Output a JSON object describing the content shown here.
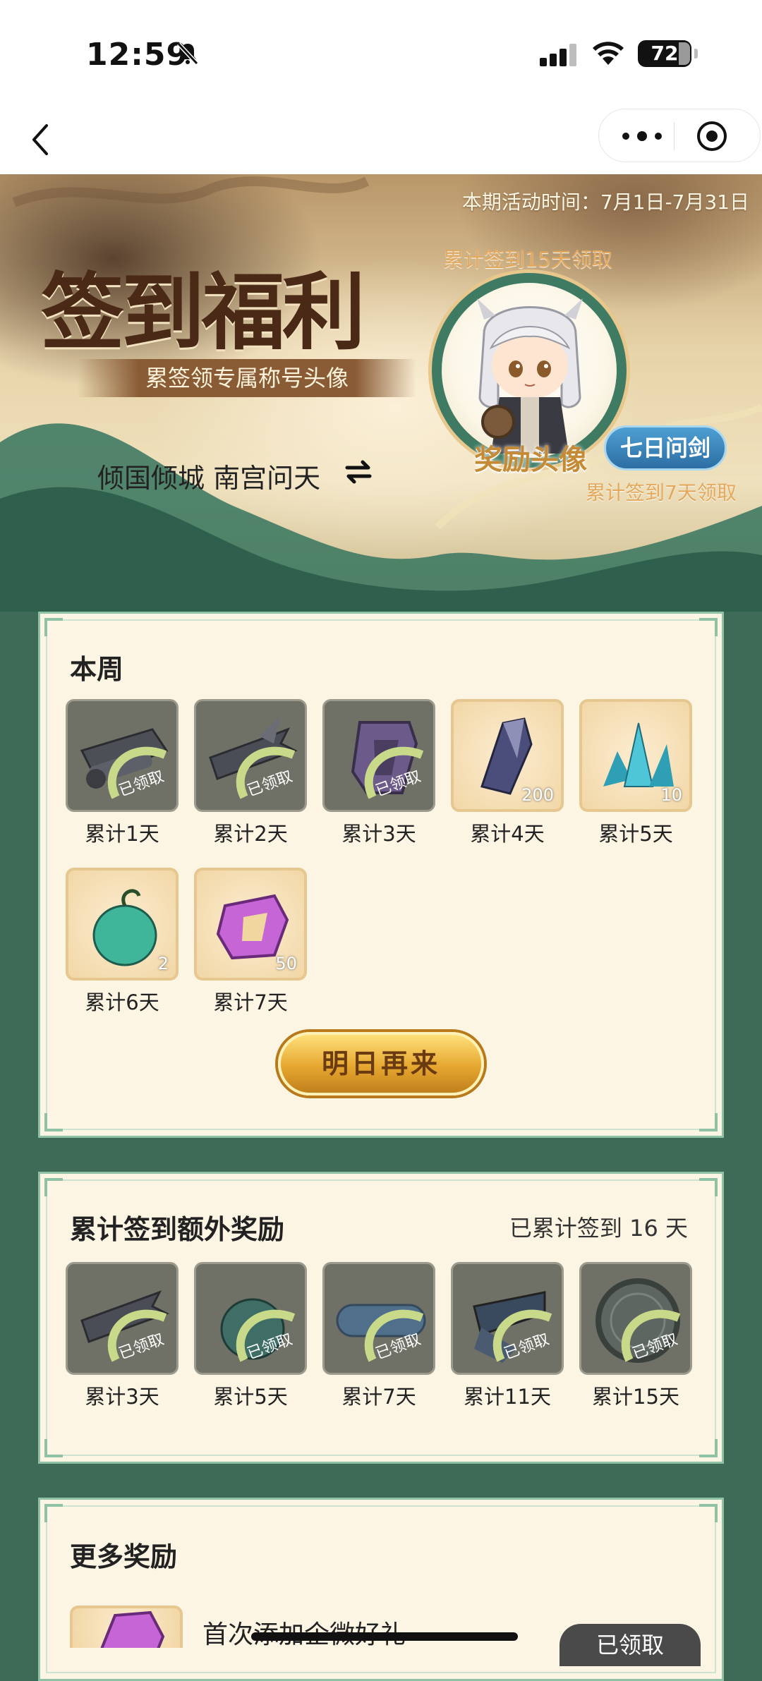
{
  "status_bar": {
    "time": "12:59",
    "battery": "72"
  },
  "banner": {
    "activity_period": "本期活动时间：7月1日-7月31日",
    "title": "签到福利",
    "subtitle": "累签领专属称号头像",
    "character_name": "倾国倾城 南宫问天",
    "tip_15": "累计签到15天领取",
    "reward_label": "奖励头像",
    "badge": "七日问剑",
    "tip_7": "累计签到7天领取"
  },
  "week": {
    "heading": "本周",
    "items": [
      {
        "label": "累计1天",
        "claimed": true
      },
      {
        "label": "累计2天",
        "claimed": true
      },
      {
        "label": "累计3天",
        "claimed": true
      },
      {
        "label": "累计4天",
        "qty": "200"
      },
      {
        "label": "累计5天",
        "qty": "10"
      },
      {
        "label": "累计6天",
        "qty": "2"
      },
      {
        "label": "累计7天",
        "qty": "50"
      }
    ],
    "claimed_stamp": "已领取",
    "button": "明日再来"
  },
  "extra": {
    "heading": "累计签到额外奖励",
    "progress": "已累计签到 16 天",
    "items": [
      {
        "label": "累计3天"
      },
      {
        "label": "累计5天"
      },
      {
        "label": "累计7天"
      },
      {
        "label": "累计11天"
      },
      {
        "label": "累计15天"
      }
    ],
    "claimed_stamp": "已领取"
  },
  "more": {
    "heading": "更多奖励",
    "item_title": "首次添加企微好礼",
    "item_button": "已领取"
  },
  "colors": {
    "accent_green": "#3f7a63",
    "panel_bg": "#fcf5e4",
    "gold": "#e6a730"
  }
}
